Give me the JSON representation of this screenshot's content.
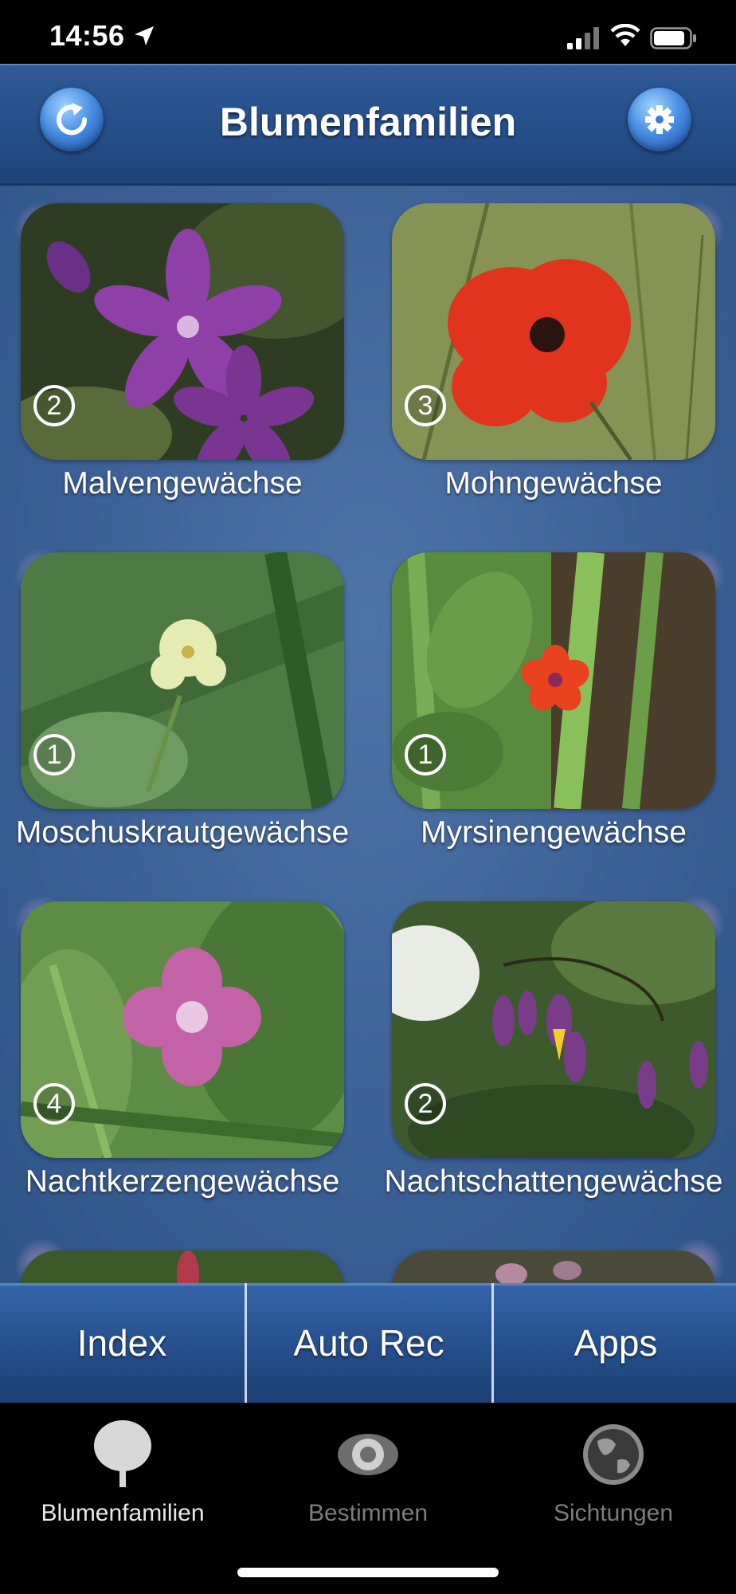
{
  "status_bar": {
    "time": "14:56",
    "icons": [
      "location-arrow-icon",
      "cellular-signal-icon",
      "wifi-icon",
      "battery-icon"
    ]
  },
  "header": {
    "title": "Blumenfamilien",
    "left_button_icon": "refresh-icon",
    "right_button_icon": "gear-icon"
  },
  "families": [
    {
      "name": "Malvengewächse",
      "count": "2"
    },
    {
      "name": "Mohngewächse",
      "count": "3"
    },
    {
      "name": "Moschuskrautgewächse",
      "count": "1"
    },
    {
      "name": "Myrsinengewächse",
      "count": "1"
    },
    {
      "name": "Nachtkerzengewächse",
      "count": "4"
    },
    {
      "name": "Nachtschattengewächse",
      "count": "2"
    }
  ],
  "toolbar": {
    "buttons": [
      "Index",
      "Auto Rec",
      "Apps"
    ]
  },
  "tab_bar": {
    "tabs": [
      {
        "label": "Blumenfamilien",
        "icon": "tree-icon",
        "active": true
      },
      {
        "label": "Bestimmen",
        "icon": "eye-icon",
        "active": false
      },
      {
        "label": "Sichtungen",
        "icon": "globe-icon",
        "active": false
      }
    ]
  },
  "colors": {
    "nav_blue": "#27508c",
    "content_blue": "#3a5f94",
    "active_tab_text": "#e9e9e9",
    "inactive_tab_text": "#7c7c7c"
  }
}
